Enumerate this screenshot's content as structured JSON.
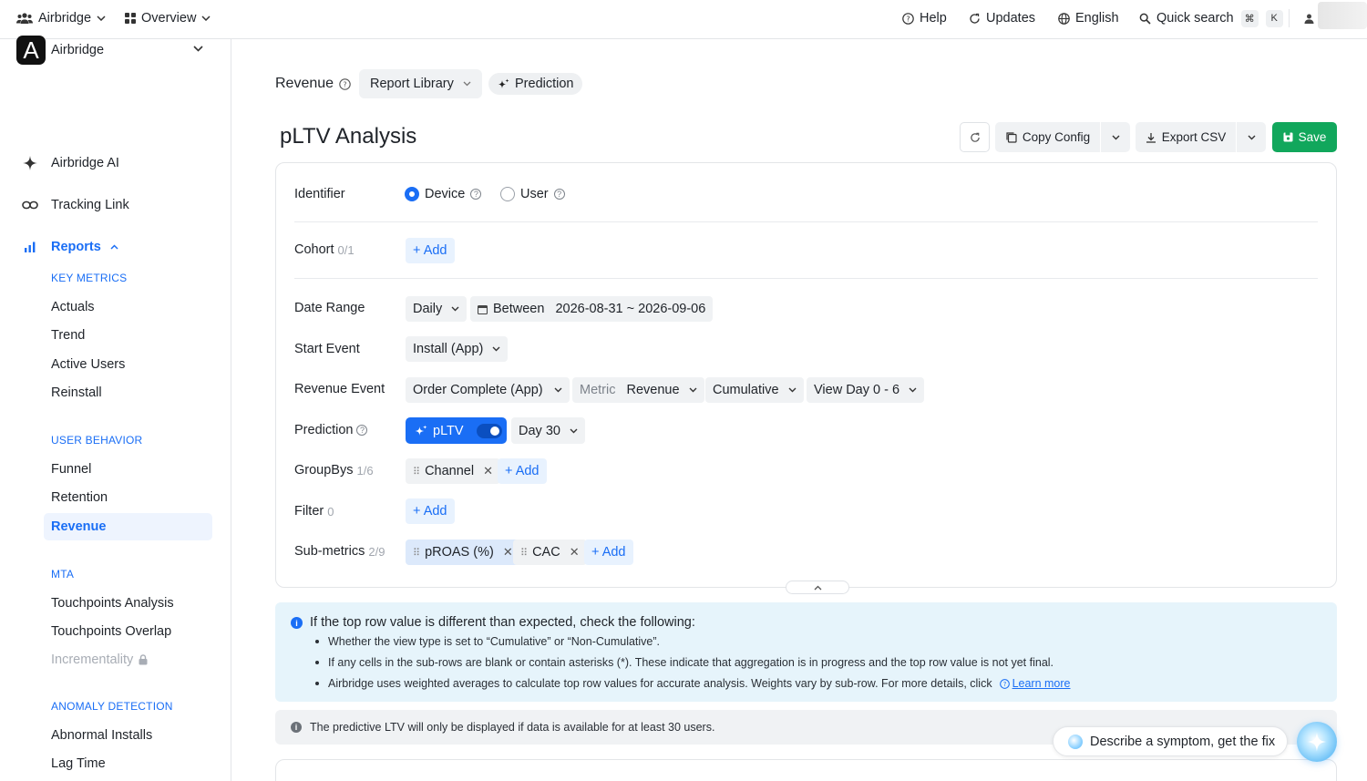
{
  "topbar": {
    "org": "Airbridge",
    "view": "Overview",
    "help": "Help",
    "updates": "Updates",
    "language": "English",
    "quick_search": "Quick search",
    "shortcut_cmd": "⌘",
    "shortcut_key": "K"
  },
  "sidebar": {
    "workspace_initial": "A",
    "workspace_name": "Airbridge",
    "ai": "Airbridge AI",
    "tracking_link": "Tracking Link",
    "reports": "Reports",
    "sections": {
      "key_metrics": "KEY METRICS",
      "user_behavior": "USER BEHAVIOR",
      "mta": "MTA",
      "anomaly": "ANOMALY DETECTION"
    },
    "items": {
      "actuals": "Actuals",
      "trend": "Trend",
      "active_users": "Active Users",
      "reinstall": "Reinstall",
      "funnel": "Funnel",
      "retention": "Retention",
      "revenue": "Revenue",
      "touchpoints_analysis": "Touchpoints Analysis",
      "touchpoints_overlap": "Touchpoints Overlap",
      "incrementality": "Incrementality",
      "abnormal_installs": "Abnormal Installs",
      "lag_time": "Lag Time"
    }
  },
  "header": {
    "section": "Revenue",
    "report_library": "Report Library",
    "prediction": "Prediction",
    "title": "pLTV Analysis",
    "copy_config": "Copy Config",
    "export_csv": "Export CSV",
    "save": "Save"
  },
  "config": {
    "identifier_label": "Identifier",
    "identifier_options": [
      "Device",
      "User"
    ],
    "identifier_selected": "Device",
    "cohort_label": "Cohort",
    "cohort_count": "0/1",
    "add": "+ Add",
    "date_range_label": "Date Range",
    "date_granularity": "Daily",
    "date_mode": "Between",
    "date_value": "2026-08-31 ~ 2026-09-06",
    "start_event_label": "Start Event",
    "start_event": "Install (App)",
    "revenue_event_label": "Revenue Event",
    "revenue_event": "Order Complete (App)",
    "metric_prefix": "Metric",
    "metric": "Revenue",
    "view_type": "Cumulative",
    "view_day": "View Day 0 - 6",
    "prediction_label": "Prediction",
    "prediction_chip": "pLTV",
    "prediction_enabled": true,
    "prediction_day": "Day 30",
    "groupbys_label": "GroupBys",
    "groupbys_count": "1/6",
    "groupbys": [
      "Channel"
    ],
    "filter_label": "Filter",
    "filter_count": "0",
    "submetrics_label": "Sub-metrics",
    "submetrics_count": "2/9",
    "submetrics": [
      "pROAS (%)",
      "CAC"
    ]
  },
  "info": {
    "title": "If the top row value is different than expected, check the following:",
    "bullets": [
      "Whether the view type is set to “Cumulative” or “Non-Cumulative”.",
      "If any cells in the sub-rows are blank or contain asterisks (*). These indicate that aggregation is in progress and the top row value is not yet final.",
      "Airbridge uses weighted averages to calculate top row values for accurate analysis. Weights vary by sub-row. For more details, click"
    ],
    "learn_more": "Learn more"
  },
  "notice": "The predictive LTV will only be displayed if data is available for at least 30 users.",
  "assistant": "Describe a symptom, get the fix"
}
